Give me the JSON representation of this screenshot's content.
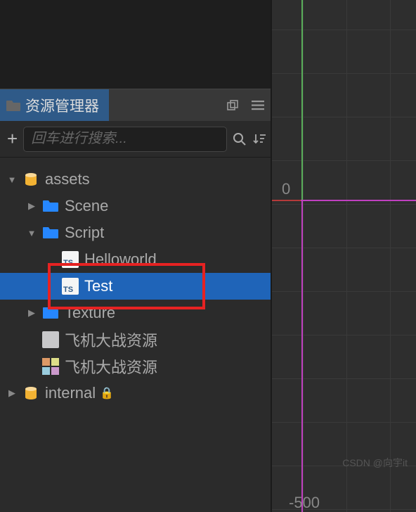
{
  "panel": {
    "title": "资源管理器"
  },
  "toolbar": {
    "search_placeholder": "回车进行搜索..."
  },
  "tree": {
    "assets": "assets",
    "scene": "Scene",
    "script": "Script",
    "helloworld": "Helloworld",
    "test": "Test",
    "texture": "Texture",
    "plane_res1": "飞机大战资源",
    "plane_res2": "飞机大战资源",
    "internal": "internal"
  },
  "axis": {
    "zero": "0",
    "neg500": "-500"
  },
  "watermark": "CSDN @向宇it",
  "icons": {
    "ts_label": "TS"
  }
}
